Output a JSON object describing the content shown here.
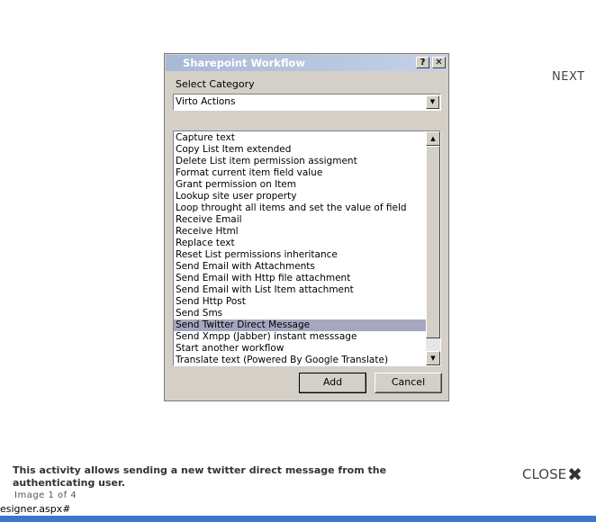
{
  "nav": {
    "next_label": "NEXT",
    "close_label": "CLOSE",
    "close_glyph": "✖"
  },
  "dialog": {
    "title": "Sharepoint Workflow",
    "help_glyph": "?",
    "close_glyph": "✕",
    "category_label": "Select Category",
    "category_value": "Virto Actions",
    "actions": [
      "Capture text",
      "Copy List Item extended",
      "Delete List item permission assigment",
      "Format current item field value",
      "Grant permission on Item",
      "Lookup site user property",
      "Loop throught all items and set the value of field",
      "Receive Email",
      "Receive Html",
      "Replace text",
      "Reset List permissions inheritance",
      "Send Email with Attachments",
      "Send Email with Http file attachment",
      "Send Email with List Item attachment",
      "Send Http Post",
      "Send Sms",
      "Send Twitter Direct Message",
      "Send Xmpp (Jabber) instant messsage",
      "Start another workflow",
      "Translate text (Powered By Google Translate)"
    ],
    "selected_action": "Send Twitter Direct Message",
    "add_label": "Add",
    "cancel_label": "Cancel",
    "selection_color": "#a6a6bf"
  },
  "caption": {
    "text": "This activity allows sending a new twitter direct message from the authenticating user.",
    "counter": "Image 1 of 4"
  },
  "status": {
    "text": "esigner.aspx#"
  }
}
